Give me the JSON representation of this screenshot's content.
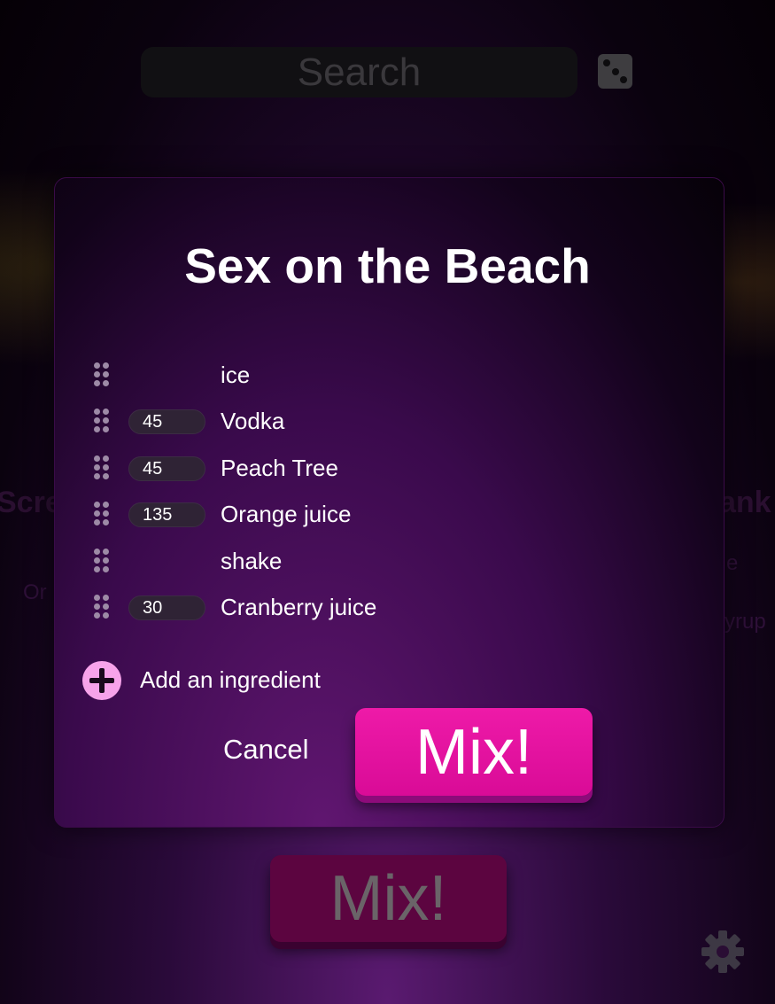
{
  "background": {
    "search": {
      "placeholder": "Search"
    },
    "card_left": {
      "title": "Scre",
      "sub": "Or"
    },
    "card_right": {
      "title": "ank",
      "sub1": "e",
      "sub2": "yrup"
    },
    "mix_label": "Mix!"
  },
  "modal": {
    "title": "Sex on the Beach",
    "ingredients": [
      {
        "amount": "",
        "name": "ice"
      },
      {
        "amount": "45",
        "name": "Vodka"
      },
      {
        "amount": "45",
        "name": "Peach Tree"
      },
      {
        "amount": "135",
        "name": "Orange juice"
      },
      {
        "amount": "",
        "name": "shake"
      },
      {
        "amount": "30",
        "name": "Cranberry juice"
      }
    ],
    "add_label": "Add an ingredient",
    "cancel_label": "Cancel",
    "mix_label": "Mix!"
  },
  "colors": {
    "accent": "#e611a3",
    "add_icon": "#f7a3ea"
  },
  "icons": [
    "dice-icon",
    "drag-handle-icon",
    "add-icon",
    "gear-icon"
  ]
}
